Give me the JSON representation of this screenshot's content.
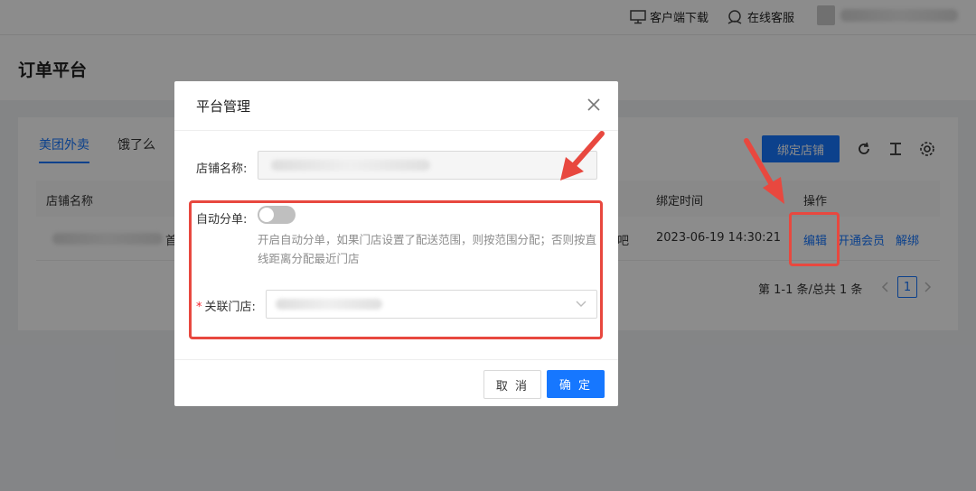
{
  "topbar": {
    "download_label": "客户端下载",
    "service_label": "在线客服"
  },
  "page": {
    "title": "订单平台"
  },
  "tabs": [
    {
      "label": "美团外卖"
    },
    {
      "label": "饿了么"
    }
  ],
  "toolbar": {
    "bind_store_label": "绑定店铺"
  },
  "table": {
    "headers": {
      "store_name": "店铺名称",
      "bind_time": "绑定时间",
      "actions": "操作"
    },
    "rows": [
      {
        "name_fragment": "首",
        "suffix_fragment": "吧",
        "bind_time": "2023-06-19 14:30:21",
        "edit": "编辑",
        "member": "开通会员",
        "unbind": "解绑"
      }
    ]
  },
  "pagination": {
    "summary": "第 1-1 条/总共 1 条",
    "current": "1"
  },
  "modal": {
    "title": "平台管理",
    "store_name_label": "店铺名称:",
    "auto_split_label": "自动分单:",
    "auto_split_enabled": false,
    "auto_split_help": "开启自动分单，如果门店设置了配送范围，则按范围分配；否则按直线距离分配最近门店",
    "linked_store_label": "关联门店:",
    "cancel_label": "取 消",
    "ok_label": "确 定"
  },
  "colors": {
    "primary": "#1677ff",
    "annotation": "#e8483f"
  }
}
